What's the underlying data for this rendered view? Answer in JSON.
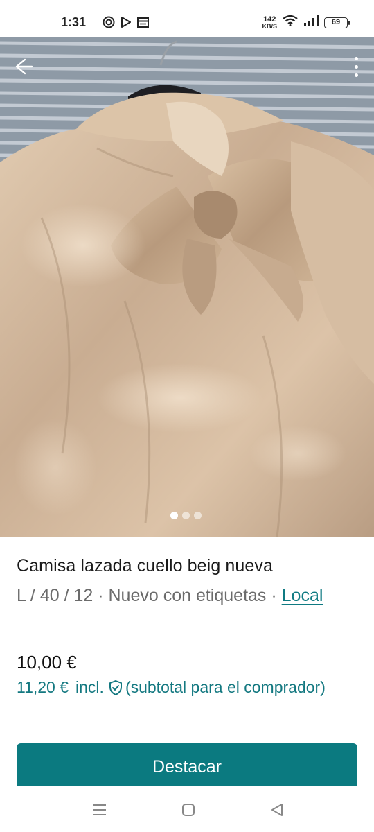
{
  "status_bar": {
    "time": "1:31",
    "net_speed_value": "142",
    "net_speed_unit": "KB/S",
    "battery": "69"
  },
  "hero": {
    "image_count": 3,
    "active_index": 0,
    "back_icon": "arrow-left-icon",
    "more_icon": "more-vertical-icon"
  },
  "product": {
    "title": "Camisa lazada cuello beig nueva",
    "meta": "L / 40 / 12 · Nuevo con etiquetas ·",
    "brand_link": "Local",
    "price": "10,00 €",
    "buyer_price": "11,20 €",
    "buyer_price_incl": "incl.",
    "buyer_price_note": "(subtotal para el comprador)"
  },
  "actions": {
    "feature_button": "Destacar"
  },
  "colors": {
    "accent": "#0b7a80",
    "link": "#0f7a82"
  },
  "nav_bar": {
    "icons": [
      "menu-icon",
      "home-square-icon",
      "back-triangle-icon"
    ]
  }
}
